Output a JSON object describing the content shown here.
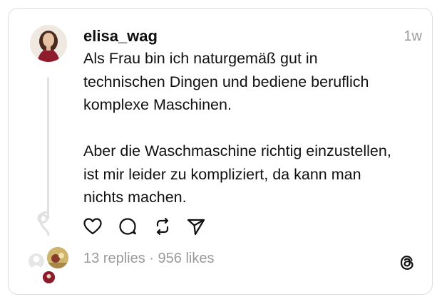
{
  "post": {
    "username": "elisa_wag",
    "time": "1w",
    "body_lines": [
      "Als Frau bin ich naturgemäß gut in",
      "technischen Dingen und bediene beruflich",
      "komplexe Maschinen.",
      "",
      "Aber die Waschmaschine richtig einzustellen,",
      "ist mir leider zu kompliziert, da kann man",
      "nichts machen."
    ],
    "replies": "13 replies",
    "separator": "·",
    "likes": "956 likes"
  },
  "icons": {
    "like": "heart-icon",
    "reply": "comment-icon",
    "repost": "repost-icon",
    "share": "send-icon",
    "brand": "threads-logo-icon"
  },
  "colors": {
    "text": "#101010",
    "muted": "#9a9a9a",
    "border": "#dcdcdc",
    "thread_line": "#e3e3e3"
  }
}
